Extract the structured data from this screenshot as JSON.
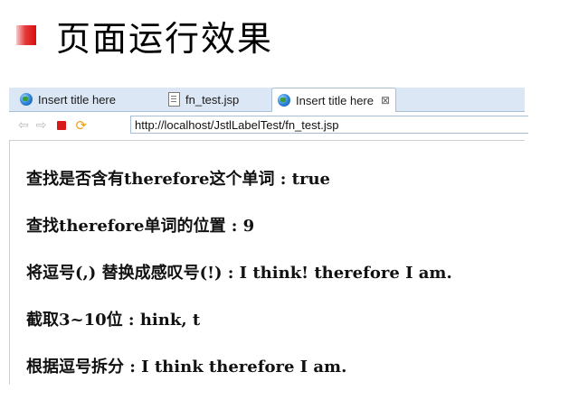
{
  "slide": {
    "title": "页面运行效果",
    "bullet_color": "#e02020"
  },
  "browser": {
    "tabs": [
      {
        "label": "Insert title here",
        "icon": "globe-icon",
        "active": false
      },
      {
        "label": "fn_test.jsp",
        "icon": "jsp-file-icon",
        "active": false
      },
      {
        "label": "Insert title here",
        "icon": "globe-icon",
        "active": true,
        "close": "⊠"
      }
    ],
    "toolbar": {
      "back": "⇦",
      "forward": "⇨",
      "refresh": "⟳",
      "url": "http://localhost/JstlLabelTest/fn_test.jsp"
    }
  },
  "content": {
    "lines": [
      "查找是否含有therefore这个单词 : true",
      "查找therefore单词的位置 : 9",
      "将逗号(,) 替换成感叹号(!) : I think! therefore I am.",
      "截取3~10位 : hink, t",
      "根据逗号拆分 : I think therefore I am."
    ]
  }
}
